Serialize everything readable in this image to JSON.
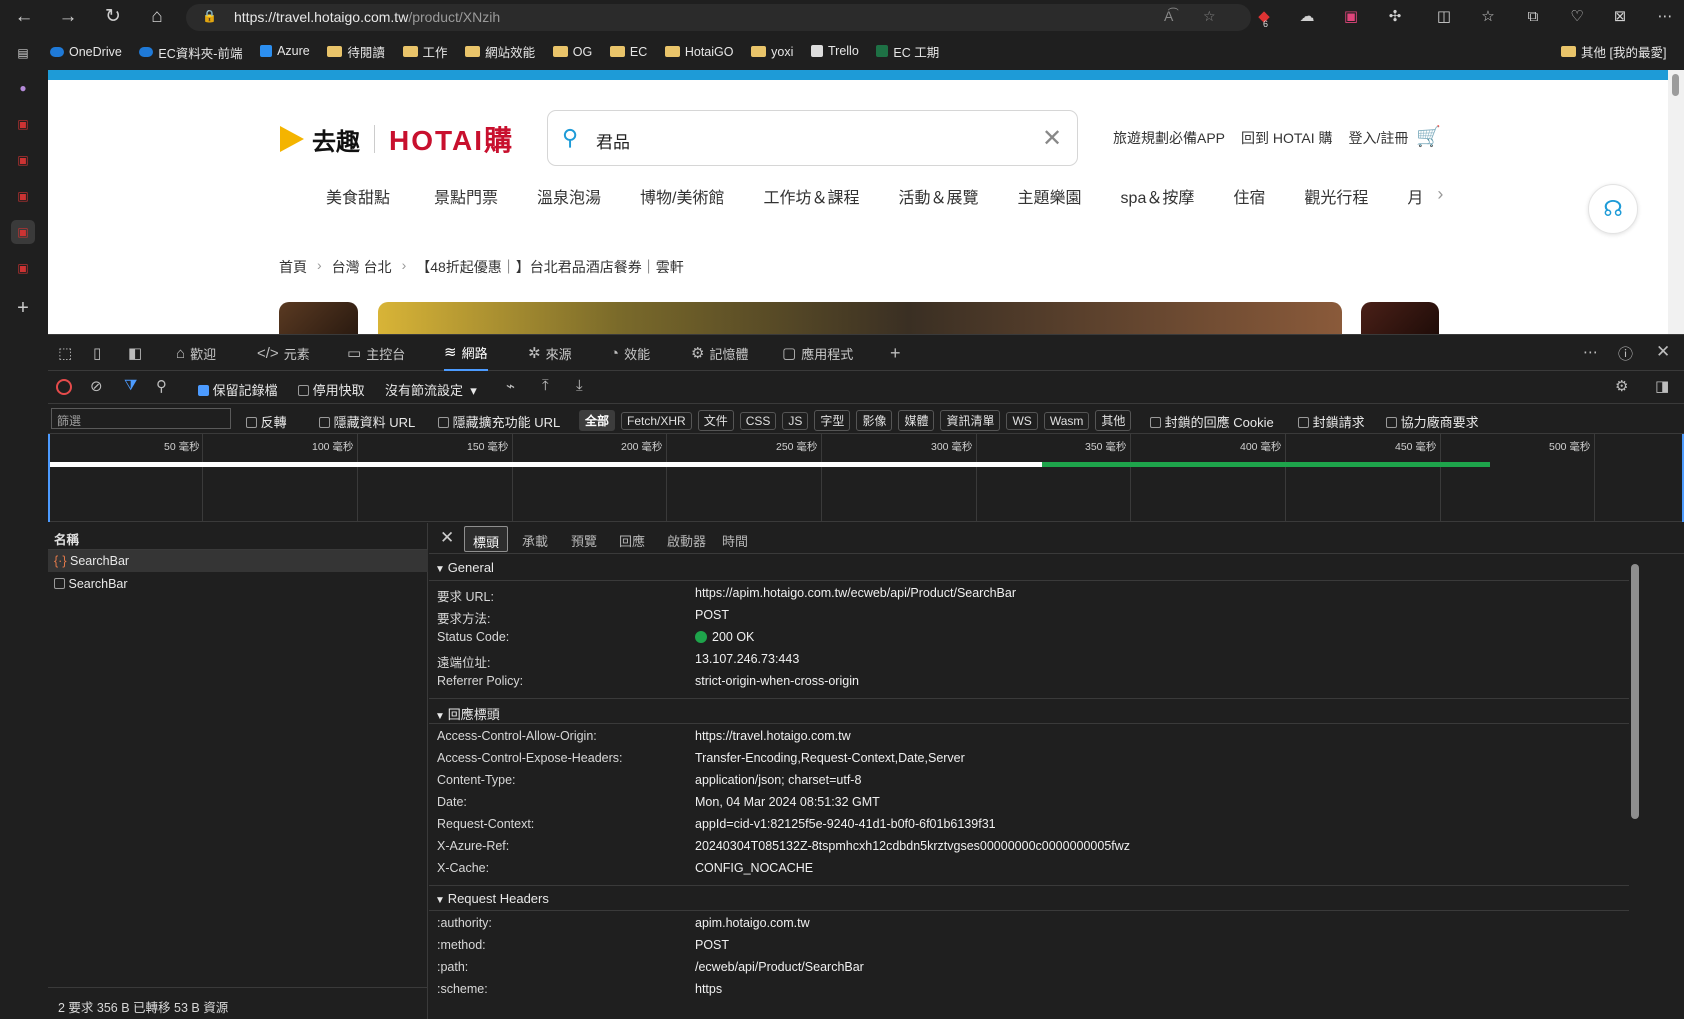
{
  "browser": {
    "url_domain": "https://travel.hotaigo.com.tw",
    "url_path": "/product/XNzih",
    "badge_count": "6",
    "bookmarks": [
      {
        "label": "OneDrive",
        "icon": "onedrive-icon"
      },
      {
        "label": "EC資料夾-前端",
        "icon": "onedrive-icon"
      },
      {
        "label": "Azure",
        "icon": "azure-icon"
      },
      {
        "label": "待閱讀",
        "icon": "folder-icon"
      },
      {
        "label": "工作",
        "icon": "folder-icon"
      },
      {
        "label": "網站效能",
        "icon": "folder-icon"
      },
      {
        "label": "OG",
        "icon": "folder-icon"
      },
      {
        "label": "EC",
        "icon": "folder-icon"
      },
      {
        "label": "HotaiGO",
        "icon": "folder-icon"
      },
      {
        "label": "yoxi",
        "icon": "folder-icon"
      },
      {
        "label": "Trello",
        "icon": "trello-icon"
      },
      {
        "label": "EC 工期",
        "icon": "excel-icon"
      }
    ],
    "other_bookmarks": "其他 [我的最愛]"
  },
  "site": {
    "logo_qq": "去趣",
    "logo_hotai": "HOTAI購",
    "search_value": "君品",
    "top_links": [
      "旅遊規劃必備APP",
      "回到 HOTAI 購",
      "登入/註冊"
    ],
    "categories": [
      "美食甜點",
      "景點門票",
      "溫泉泡湯",
      "博物/美術館",
      "工作坊＆課程",
      "活動＆展覽",
      "主題樂園",
      "spa＆按摩",
      "住宿",
      "觀光行程",
      "月"
    ],
    "breadcrumb": [
      "首頁",
      "台灣 台北",
      "【48折起優惠｜】台北君品酒店餐券｜雲軒"
    ]
  },
  "devtools": {
    "main_tabs": [
      "歡迎",
      "元素",
      "主控台",
      "網路",
      "來源",
      "效能",
      "記憶體",
      "應用程式"
    ],
    "active_tab": "網路",
    "toolbar": {
      "preserve_log": "保留記錄檔",
      "disable_cache": "停用快取",
      "throttling": "沒有節流設定"
    },
    "filter": {
      "placeholder": "篩選",
      "invert": "反轉",
      "hide_data_urls": "隱藏資料 URL",
      "hide_extension_urls": "隱藏擴充功能 URL",
      "types": [
        "全部",
        "Fetch/XHR",
        "文件",
        "CSS",
        "JS",
        "字型",
        "影像",
        "媒體",
        "資訊清單",
        "WS",
        "Wasm",
        "其他"
      ],
      "blocked_cookies": "封鎖的回應 Cookie",
      "blocked_requests": "封鎖請求",
      "third_party": "協力廠商要求"
    },
    "timeline_ticks": [
      "50 毫秒",
      "100 毫秒",
      "150 毫秒",
      "200 毫秒",
      "250 毫秒",
      "300 毫秒",
      "350 毫秒",
      "400 毫秒",
      "450 毫秒",
      "500 毫秒"
    ],
    "request_list": {
      "header": "名稱",
      "items": [
        "SearchBar",
        "SearchBar"
      ],
      "status": "2 要求  356 B 已轉移  53 B 資源"
    },
    "detail_tabs": [
      "標頭",
      "承載",
      "預覽",
      "回應",
      "啟動器",
      "時間"
    ],
    "general": {
      "title": "General",
      "rows": [
        {
          "k": "要求 URL:",
          "v": "https://apim.hotaigo.com.tw/ecweb/api/Product/SearchBar"
        },
        {
          "k": "要求方法:",
          "v": "POST"
        },
        {
          "k": "Status Code:",
          "v": "200 OK"
        },
        {
          "k": "遠端位址:",
          "v": "13.107.246.73:443"
        },
        {
          "k": "Referrer Policy:",
          "v": "strict-origin-when-cross-origin"
        }
      ]
    },
    "response_headers": {
      "title": "回應標頭",
      "rows": [
        {
          "k": "Access-Control-Allow-Origin:",
          "v": "https://travel.hotaigo.com.tw"
        },
        {
          "k": "Access-Control-Expose-Headers:",
          "v": "Transfer-Encoding,Request-Context,Date,Server"
        },
        {
          "k": "Content-Type:",
          "v": "application/json; charset=utf-8"
        },
        {
          "k": "Date:",
          "v": "Mon, 04 Mar 2024 08:51:32 GMT"
        },
        {
          "k": "Request-Context:",
          "v": "appId=cid-v1:82125f5e-9240-41d1-b0f0-6f01b6139f31"
        },
        {
          "k": "X-Azure-Ref:",
          "v": "20240304T085132Z-8tspmhcxh12cdbdn5krztvgses00000000c0000000005fwz"
        },
        {
          "k": "X-Cache:",
          "v": "CONFIG_NOCACHE"
        }
      ]
    },
    "request_headers": {
      "title": "Request Headers",
      "rows": [
        {
          "k": ":authority:",
          "v": "apim.hotaigo.com.tw"
        },
        {
          "k": ":method:",
          "v": "POST"
        },
        {
          "k": ":path:",
          "v": "/ecweb/api/Product/SearchBar"
        },
        {
          "k": ":scheme:",
          "v": "https"
        }
      ]
    }
  }
}
